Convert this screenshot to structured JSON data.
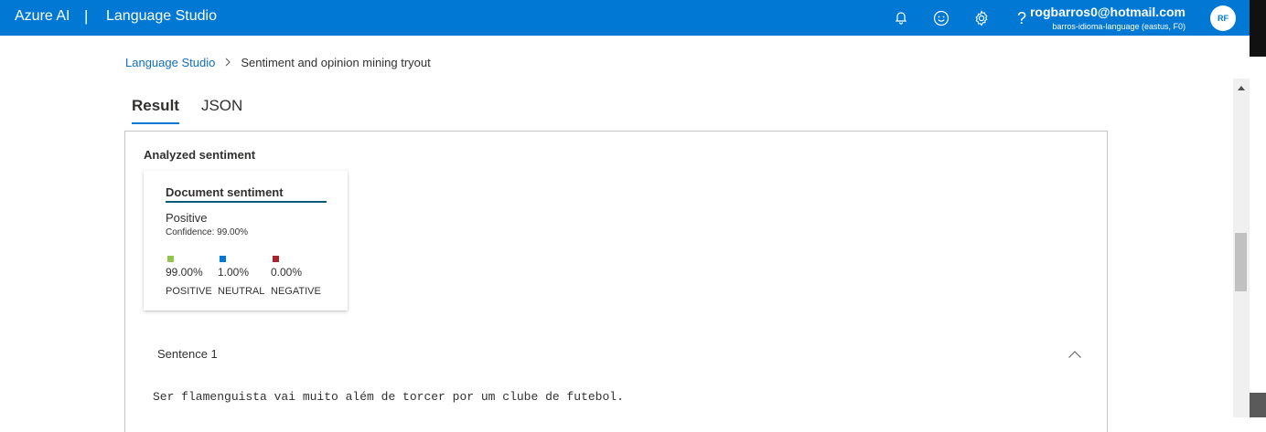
{
  "header": {
    "brand": "Azure AI",
    "separator": "|",
    "product": "Language Studio",
    "icons": [
      "bell-icon",
      "smiley-icon",
      "gear-icon",
      "help-icon"
    ],
    "user": {
      "email": "rogbarros0@hotmail.com",
      "resource": "barros-idioma-language (eastus, F0)",
      "initials": "RF"
    }
  },
  "breadcrumb": {
    "root": "Language Studio",
    "current": "Sentiment and opinion mining tryout"
  },
  "tabs": [
    {
      "label": "Result",
      "active": true
    },
    {
      "label": "JSON",
      "active": false
    }
  ],
  "result": {
    "section_title": "Analyzed sentiment",
    "card": {
      "title": "Document sentiment",
      "label": "Positive",
      "confidence": "Confidence: 99.00%",
      "metrics": [
        {
          "value": "99.00%",
          "label": "POSITIVE",
          "color": "#92c353"
        },
        {
          "value": "1.00%",
          "label": "NEUTRAL",
          "color": "#0078d4"
        },
        {
          "value": "0.00%",
          "label": "NEGATIVE",
          "color": "#a4262c"
        }
      ]
    },
    "sentence": {
      "title": "Sentence 1",
      "text": "Ser flamenguista vai muito além de torcer por um clube de futebol."
    }
  }
}
